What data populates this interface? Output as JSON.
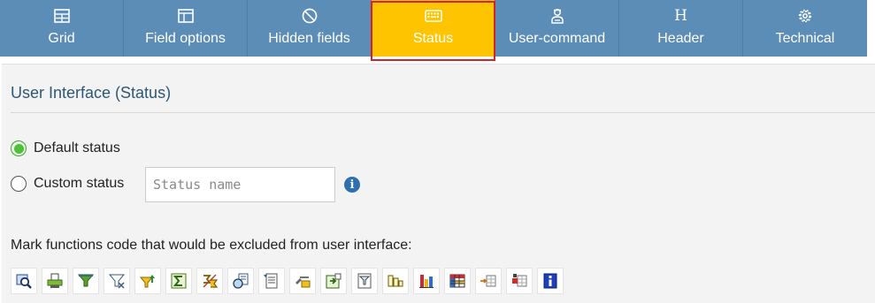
{
  "tabs": [
    {
      "label": "Grid",
      "icon": "grid-icon"
    },
    {
      "label": "Field options",
      "icon": "field-options-icon"
    },
    {
      "label": "Hidden fields",
      "icon": "prohibited-icon"
    },
    {
      "label": "Status",
      "icon": "keyboard-icon",
      "active": true
    },
    {
      "label": "User-command",
      "icon": "user-command-icon"
    },
    {
      "label": "Header",
      "icon": "header-h-icon",
      "glyph": "H"
    },
    {
      "label": "Technical",
      "icon": "gear-icon"
    }
  ],
  "panel": {
    "title": "User Interface (Status)",
    "default_status_label": "Default status",
    "custom_status_label": "Custom status",
    "status_placeholder": "Status name",
    "info_glyph": "i",
    "mark_label": "Mark functions code that would be excluded from user interface:"
  },
  "colors": {
    "tabbar": "#5b8db7",
    "active_tab": "#ffc400",
    "active_outline": "#d2232a",
    "title": "#2c5877"
  },
  "function_icons": [
    "find-icon",
    "print-icon",
    "filter-icon",
    "filter-settings-icon",
    "sort-icon",
    "sum-icon",
    "subtotal-icon",
    "details-icon",
    "export-icon",
    "layout-icon",
    "local-file-icon",
    "print-preview-icon",
    "abc-analysis-icon",
    "graphic-icon",
    "grid-color-icon",
    "layout-save-icon",
    "layout-change-icon",
    "info-icon"
  ]
}
